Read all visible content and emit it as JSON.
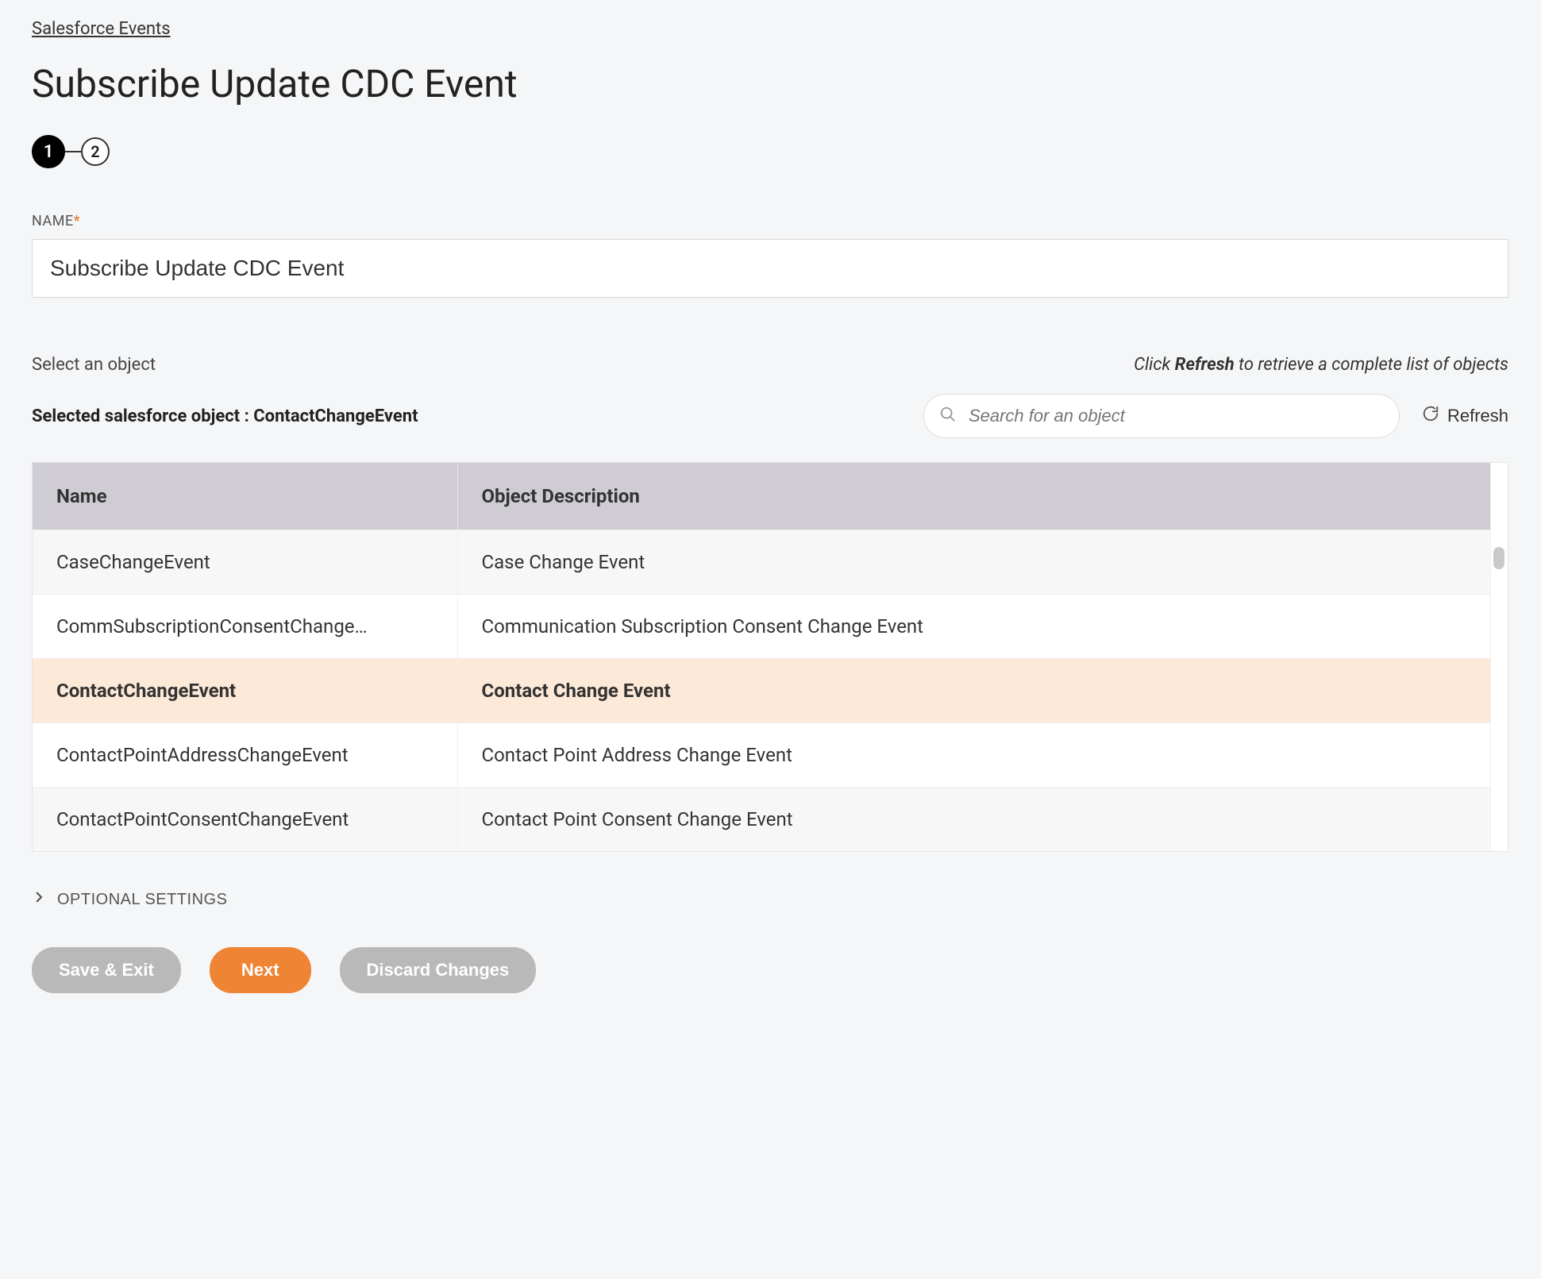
{
  "breadcrumb": {
    "label": "Salesforce Events"
  },
  "page_title": "Subscribe Update CDC Event",
  "stepper": {
    "steps": [
      "1",
      "2"
    ],
    "active_index": 0
  },
  "name_field": {
    "label": "NAME",
    "required_marker": "*",
    "value": "Subscribe Update CDC Event"
  },
  "object_section": {
    "select_label": "Select an object",
    "hint_prefix": "Click ",
    "hint_bold": "Refresh",
    "hint_suffix": " to retrieve a complete list of objects",
    "selected_prefix": "Selected salesforce object : ",
    "selected_value": "ContactChangeEvent",
    "search_placeholder": "Search for an object",
    "refresh_label": "Refresh"
  },
  "table": {
    "columns": {
      "name": "Name",
      "description": "Object Description"
    },
    "rows": [
      {
        "name": "CaseChangeEvent",
        "description": "Case Change Event",
        "alt": true,
        "selected": false
      },
      {
        "name": "CommSubscriptionConsentChange…",
        "description": "Communication Subscription Consent Change Event",
        "alt": false,
        "selected": false
      },
      {
        "name": "ContactChangeEvent",
        "description": "Contact Change Event",
        "alt": false,
        "selected": true
      },
      {
        "name": "ContactPointAddressChangeEvent",
        "description": "Contact Point Address Change Event",
        "alt": false,
        "selected": false
      },
      {
        "name": "ContactPointConsentChangeEvent",
        "description": "Contact Point Consent Change Event",
        "alt": true,
        "selected": false
      }
    ]
  },
  "optional_settings": {
    "label": "OPTIONAL SETTINGS"
  },
  "footer": {
    "save_exit": "Save & Exit",
    "next": "Next",
    "discard": "Discard Changes"
  }
}
